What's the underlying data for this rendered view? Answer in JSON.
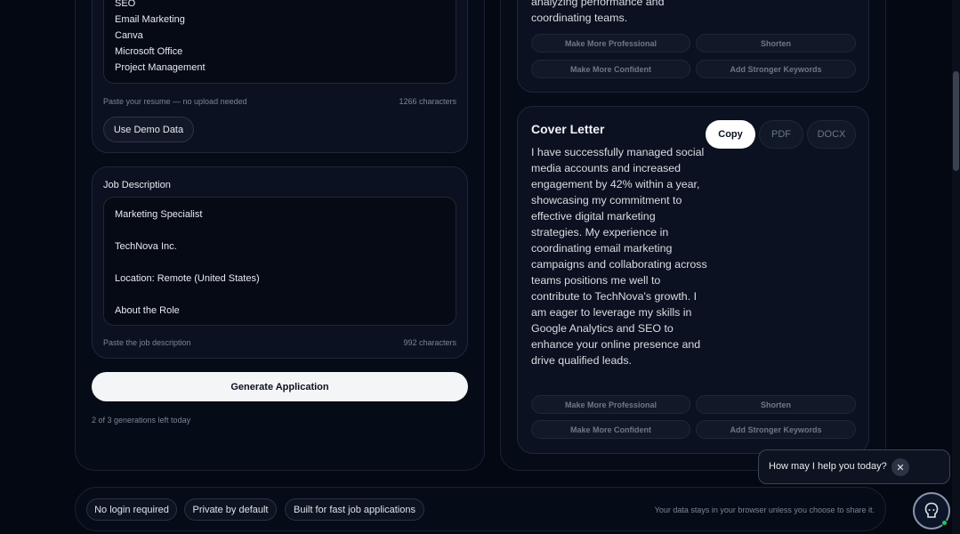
{
  "resume": {
    "lines": [
      "SEO",
      "Email Marketing",
      "Canva",
      "Microsoft Office",
      "Project Management"
    ],
    "hint": "Paste your resume — no upload needed",
    "char_count": "1266 characters",
    "demo_button": "Use Demo Data"
  },
  "job": {
    "label": "Job Description",
    "lines": [
      "Marketing Specialist",
      "TechNova Inc.",
      "Location: Remote (United States)",
      "About the Role"
    ],
    "hint": "Paste the job description",
    "char_count": "992 characters"
  },
  "generate": {
    "label": "Generate Application",
    "quota": "2 of 3 generations left today"
  },
  "resume_output": {
    "tail_text": "analyzing performance and coordinating teams.",
    "actions": [
      "Make More Professional",
      "Shorten",
      "Make More Confident",
      "Add Stronger Keywords"
    ]
  },
  "cover_letter": {
    "title": "Cover Letter",
    "copy": "Copy",
    "pdf": "PDF",
    "docx": "DOCX",
    "body": "I have successfully managed social media accounts and increased engagement by 42% within a year, showcasing my commitment to effective digital marketing strategies. My experience in coordinating email marketing campaigns and collaborating across teams positions me well to contribute to TechNova's growth. I am eager to leverage my skills in Google Analytics and SEO to enhance your online presence and drive qualified leads.",
    "actions": [
      "Make More Professional",
      "Shorten",
      "Make More Confident",
      "Add Stronger Keywords"
    ]
  },
  "footer": {
    "badges": [
      "No login required",
      "Private by default",
      "Built for fast job applications"
    ],
    "privacy": "Your data stays in your browser unless you choose to share it."
  },
  "chat": {
    "prompt": "How may I help you today?",
    "close": "✕"
  }
}
